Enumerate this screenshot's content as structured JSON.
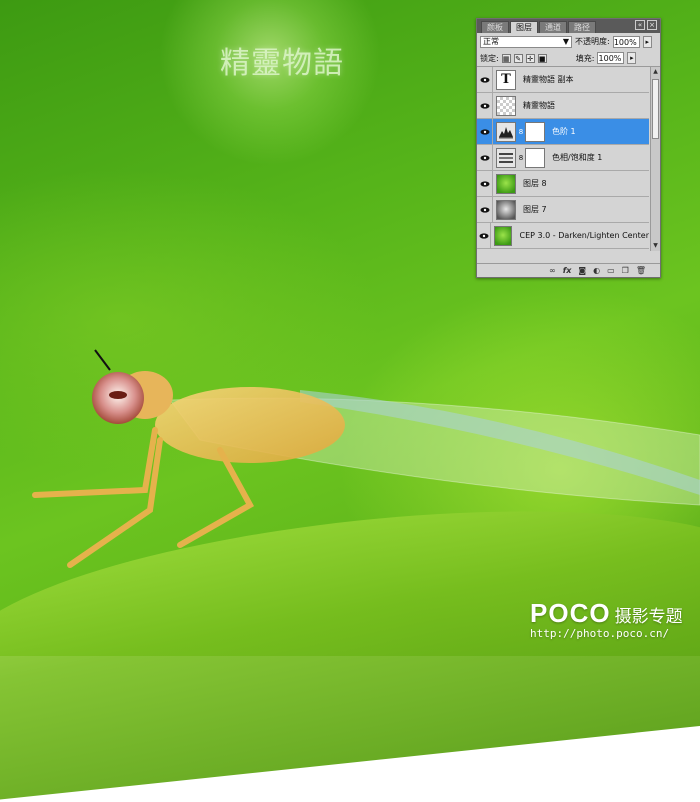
{
  "watermark": {
    "title": "精靈物語",
    "brand": "POCO",
    "brand_sub": "摄影专题",
    "url": "http://photo.poco.cn/"
  },
  "panel": {
    "tabs": [
      {
        "label": "颜板",
        "active": false
      },
      {
        "label": "图层",
        "active": true
      },
      {
        "label": "通道",
        "active": false
      },
      {
        "label": "路径",
        "active": false
      }
    ],
    "blend_mode": "正常",
    "opacity_label": "不透明度:",
    "opacity_value": "100%",
    "lock_label": "锁定:",
    "fill_label": "填充:",
    "fill_value": "100%",
    "layers": [
      {
        "name": "精靈物語 副本",
        "thumb": "text",
        "thumb_glyph": "T",
        "selected": false,
        "mask": false
      },
      {
        "name": "精靈物語",
        "thumb": "transparent",
        "selected": false,
        "mask": false
      },
      {
        "name": "色阶 1",
        "thumb": "levels-adjustment",
        "selected": true,
        "mask": true
      },
      {
        "name": "色相/饱和度 1",
        "thumb": "hue-saturation-adjustment",
        "selected": false,
        "mask": true
      },
      {
        "name": "图层 8",
        "thumb": "green-image",
        "selected": false,
        "mask": false
      },
      {
        "name": "图层 7",
        "thumb": "gray-image",
        "selected": false,
        "mask": false
      },
      {
        "name": "CEP 3.0 - Darken/Lighten Center",
        "thumb": "green-image",
        "selected": false,
        "mask": false
      }
    ],
    "footer_icons": [
      "link-icon",
      "fx-icon",
      "mask-icon",
      "adjustment-icon",
      "group-icon",
      "new-layer-icon",
      "trash-icon"
    ],
    "colors": {
      "selected": "#3a8ee6",
      "panel_bg": "#d4d4d4",
      "tab_bar": "#5a5a5a"
    }
  }
}
